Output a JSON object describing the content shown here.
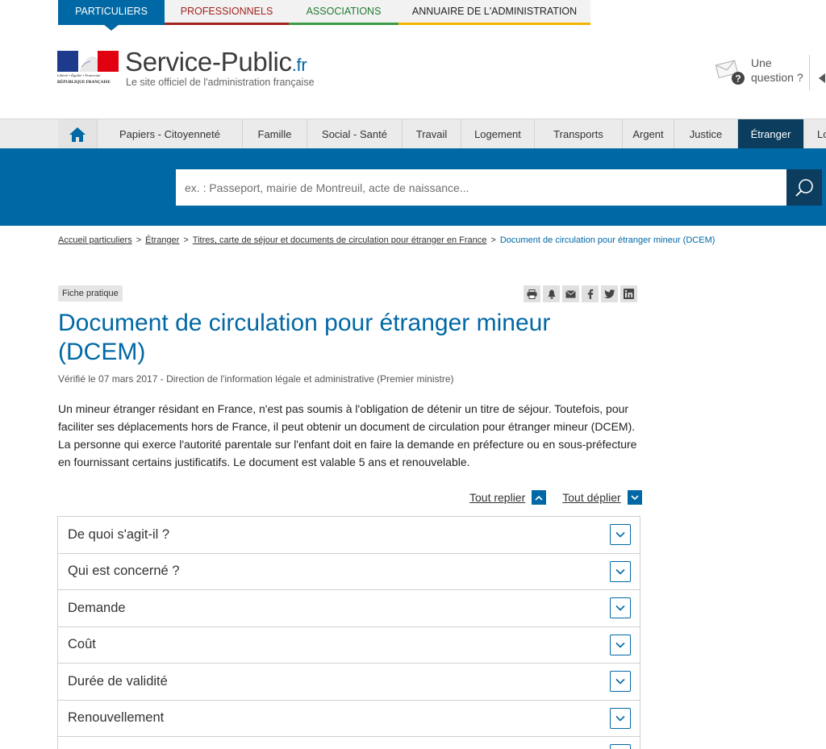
{
  "audience_tabs": [
    {
      "label": "PARTICULIERS"
    },
    {
      "label": "PROFESSIONNELS"
    },
    {
      "label": "ASSOCIATIONS"
    },
    {
      "label": "ANNUAIRE DE L'ADMINISTRATION"
    }
  ],
  "header": {
    "motto": "Liberté • Égalité • Fraternité",
    "republic": "RÉPUBLIQUE FRANÇAISE",
    "site_name": "Service-Public",
    "site_tld": ".fr",
    "tagline": "Le site officiel de l'administration française",
    "help_label": "Une question ?"
  },
  "nav": {
    "items": [
      {
        "label": "Papiers - Citoyenneté"
      },
      {
        "label": "Famille"
      },
      {
        "label": "Social - Santé"
      },
      {
        "label": "Travail"
      },
      {
        "label": "Logement"
      },
      {
        "label": "Transports"
      },
      {
        "label": "Argent"
      },
      {
        "label": "Justice"
      },
      {
        "label": "Étranger"
      },
      {
        "label": "Lo"
      }
    ]
  },
  "search": {
    "placeholder": "ex. : Passeport, mairie de Montreuil, acte de naissance..."
  },
  "breadcrumb": {
    "items": [
      {
        "label": "Accueil particuliers"
      },
      {
        "label": "Étranger"
      },
      {
        "label": "Titres, carte de séjour et documents de circulation pour étranger en France"
      }
    ],
    "current": "Document de circulation pour étranger mineur (DCEM)"
  },
  "content": {
    "badge": "Fiche pratique",
    "title": "Document de circulation pour étranger mineur (DCEM)",
    "verified": "Vérifié le 07 mars 2017 - Direction de l'information légale et administrative (Premier ministre)",
    "intro": "Un mineur étranger résidant en France, n'est pas soumis à l'obligation de détenir un titre de séjour. Toutefois, pour faciliter ses déplacements hors de France, il peut obtenir un document de circulation pour étranger mineur (DCEM). La personne qui exerce l'autorité parentale sur l'enfant doit en faire la demande en préfecture ou en sous-préfecture en fournissant certains justificatifs. Le document est valable 5 ans et renouvelable.",
    "collapse_all": "Tout replier",
    "expand_all": "Tout déplier",
    "sections": [
      {
        "label": "De quoi s'agit-il ?"
      },
      {
        "label": "Qui est concerné ?"
      },
      {
        "label": "Demande"
      },
      {
        "label": "Coût"
      },
      {
        "label": "Durée de validité"
      },
      {
        "label": "Renouvellement"
      },
      {
        "label": ""
      }
    ]
  },
  "share_icons": [
    "print-icon",
    "bell-icon",
    "mail-icon",
    "facebook-icon",
    "twitter-icon",
    "linkedin-icon"
  ],
  "colors": {
    "primary": "#0068a5",
    "dark": "#0c3d5e",
    "pro": "#a3231f",
    "asso": "#3d9a45",
    "annuaire": "#f2b600"
  }
}
